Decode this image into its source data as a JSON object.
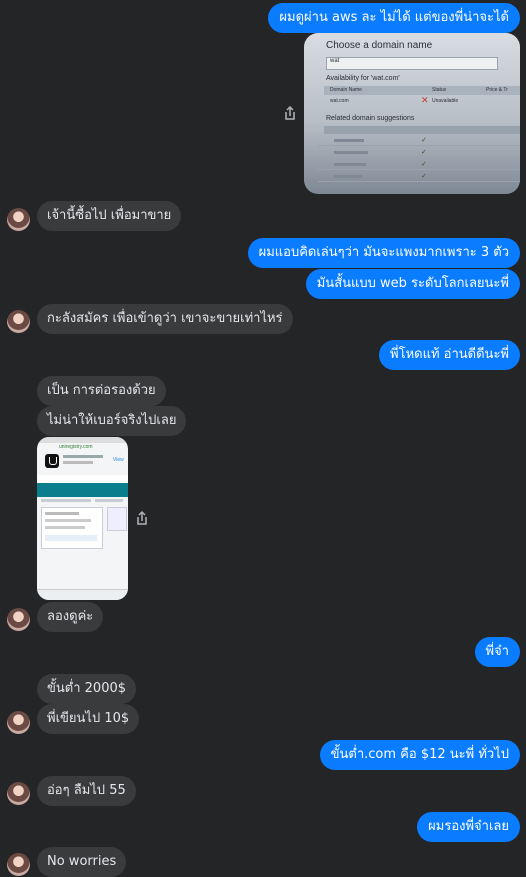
{
  "messages": {
    "m1": "ผมดูผ่าน aws ละ ไม่ได้ แต่ของพี่น่าจะได้",
    "m2": "เจ้านี้ซื้อไป เพื่อมาขาย",
    "m3": "ผมแอบคิดเล่นๆว่า มันจะแพงมากเพราะ 3 ตัว",
    "m4": "มันสั้นแบบ web ระดับโลกเลยนะพี่",
    "m5": "กะลังสมัคร เพื่อเข้าดูว่า เขาจะขายเท่าไหร่",
    "m6": "พี่โหดแท้ อ่านดีดีนะพี่",
    "m7": "เป็น การต่อรองด้วย",
    "m8": "ไม่น่าให้เบอร์จริงไปเลย",
    "m9": "ลองดูค่ะ",
    "m10": "พี่จ๋า",
    "m11": "ขั้นต่ำ 2000$",
    "m12": "พี่เขียนไป 10$",
    "m13": "ขั้นต่ำ.com คือ $12 นะพี่ ทั่วไป",
    "m14": "อ่อๆ ลืมไป 55",
    "m15": "ผมรองพี่จ๋าเลย",
    "m16": "No worries"
  },
  "domain_screenshot": {
    "title": "Choose a domain name",
    "query": "wat",
    "availability": "Availability for 'wat.com'",
    "col_domain": "Domain Name",
    "col_status": "Status",
    "col_price": "Price & Tr",
    "result_domain": "wat.com",
    "result_status": "Unavailable",
    "related": "Related domain suggestions"
  },
  "phone_screenshot": {
    "url": "uniregistry.com",
    "view": "View"
  },
  "icons": {
    "share": "share-icon",
    "avatar": "avatar"
  },
  "colors": {
    "background": "#242526",
    "outgoing": "#0a7cff",
    "incoming": "#3a3b3c"
  }
}
